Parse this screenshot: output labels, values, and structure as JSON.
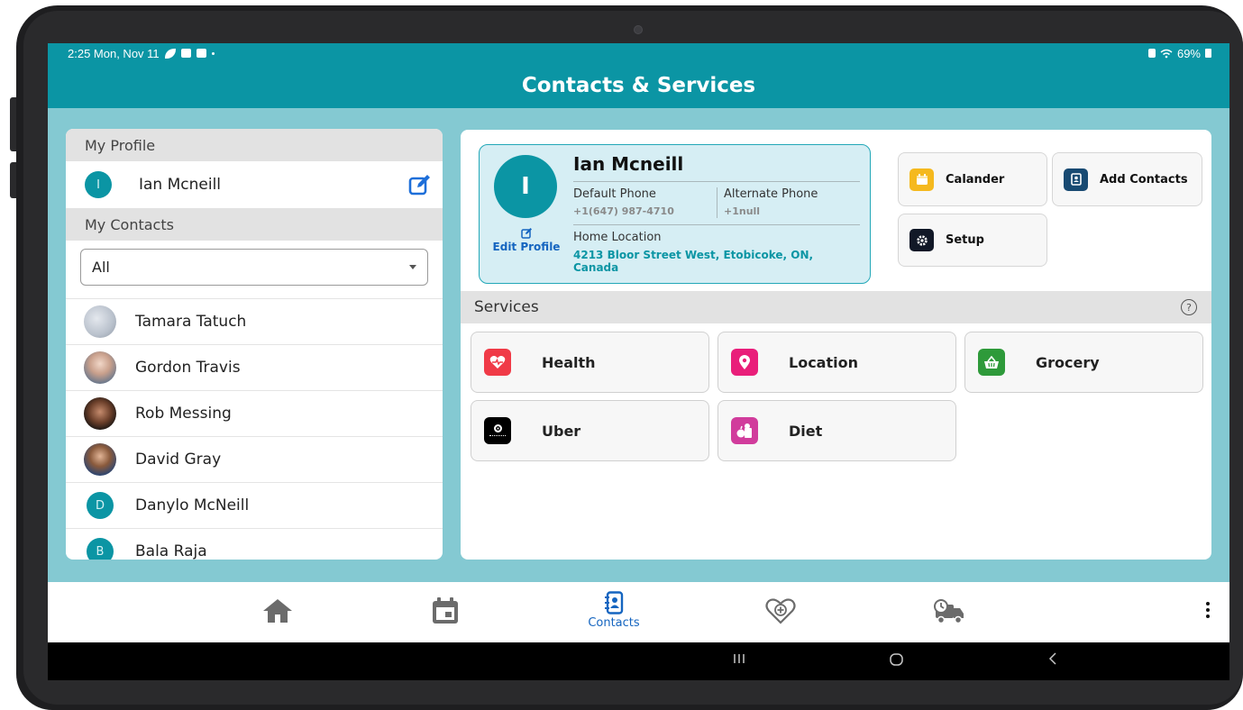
{
  "status_bar": {
    "time_date": "2:25  Mon, Nov 11",
    "battery": "69%"
  },
  "header": {
    "title": "Contacts & Services"
  },
  "left_panel": {
    "my_profile_heading": "My Profile",
    "profile": {
      "initial": "I",
      "name": "Ian Mcneill"
    },
    "my_contacts_heading": "My Contacts",
    "filter": {
      "selected": "All"
    },
    "contacts": [
      {
        "name": "Tamara Tatuch",
        "avatar": "photo"
      },
      {
        "name": "Gordon Travis",
        "avatar": "photo"
      },
      {
        "name": "Rob Messing",
        "avatar": "photo"
      },
      {
        "name": "David Gray",
        "avatar": "photo"
      },
      {
        "name": "Danylo McNeill",
        "avatar": "letter",
        "initial": "D"
      },
      {
        "name": "Bala Raja",
        "avatar": "letter",
        "initial": "B"
      }
    ]
  },
  "profile_card": {
    "initial": "I",
    "name": "Ian Mcneill",
    "edit_label": "Edit Profile",
    "default_phone_label": "Default Phone",
    "default_phone": "+1(647) 987-4710",
    "alternate_phone_label": "Alternate Phone",
    "alternate_phone": "+1null",
    "home_location_label": "Home Location",
    "home_location": "4213 Bloor Street West, Etobicoke, ON, Canada"
  },
  "quick_actions": {
    "calendar": "Calander",
    "add_contacts": "Add Contacts",
    "setup": "Setup"
  },
  "services": {
    "heading": "Services",
    "help_glyph": "?",
    "items": [
      {
        "label": "Health",
        "icon": "heart-pulse-icon",
        "color": "#f03a47"
      },
      {
        "label": "Location",
        "icon": "map-pin-icon",
        "color": "#e91e7a"
      },
      {
        "label": "Grocery",
        "icon": "basket-icon",
        "color": "#2e9a3a"
      },
      {
        "label": "Uber",
        "icon": "uber-logo-icon",
        "color": "#000000"
      },
      {
        "label": "Diet",
        "icon": "diet-icon",
        "color": "#d13c9c"
      }
    ]
  },
  "bottom_nav": {
    "items": [
      {
        "icon": "home-icon"
      },
      {
        "icon": "calendar-icon"
      },
      {
        "icon": "contacts-icon",
        "label": "Contacts",
        "active": true
      },
      {
        "icon": "health-plus-icon"
      },
      {
        "icon": "delivery-truck-icon"
      }
    ]
  },
  "colors": {
    "primary": "#0b95a4",
    "background": "#84c9d2",
    "active_nav": "#1565c0"
  }
}
